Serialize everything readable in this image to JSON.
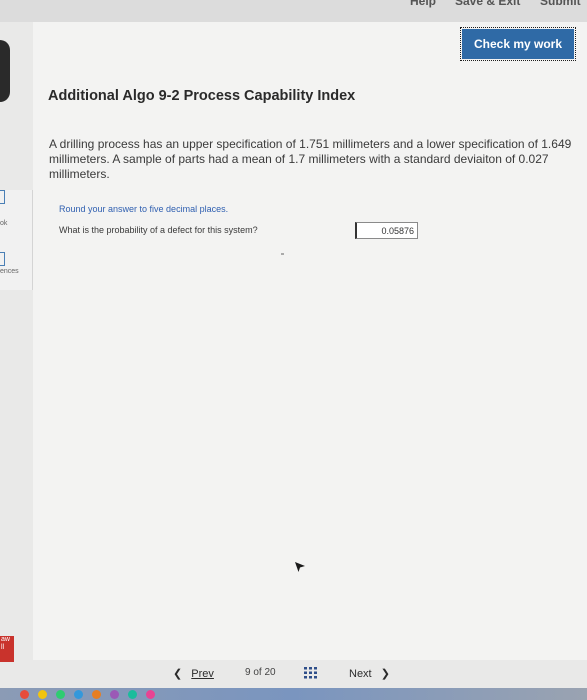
{
  "header": {
    "help_label": "Help",
    "save_exit_label": "Save & Exit",
    "submit_label": "Submit",
    "check_my_work_label": "Check my work"
  },
  "sidebar": {
    "book_label": "ok",
    "references_label": "ences"
  },
  "question": {
    "title": "Additional Algo 9-2 Process Capability Index",
    "problem_text": "A drilling process has an upper specification of 1.751 millimeters and a lower specification of 1.649 millimeters. A sample of parts had a mean of 1.7 millimeters with a standard deviaiton of 0.027 millimeters.",
    "instruction": "Round your answer to five decimal places.",
    "prompt": "What is the probability of a defect for this system?",
    "answer_value": "0.05876"
  },
  "navigation": {
    "prev_label": "Prev",
    "current_page": "9",
    "of_label": "of",
    "total_pages": "20",
    "next_label": "Next"
  },
  "bottom_left": {
    "line1": "aw",
    "line2": "ll"
  },
  "colors": {
    "accent": "#2f6aa6",
    "instruction_blue": "#2f5fb0",
    "background": "#f3f3f2"
  }
}
